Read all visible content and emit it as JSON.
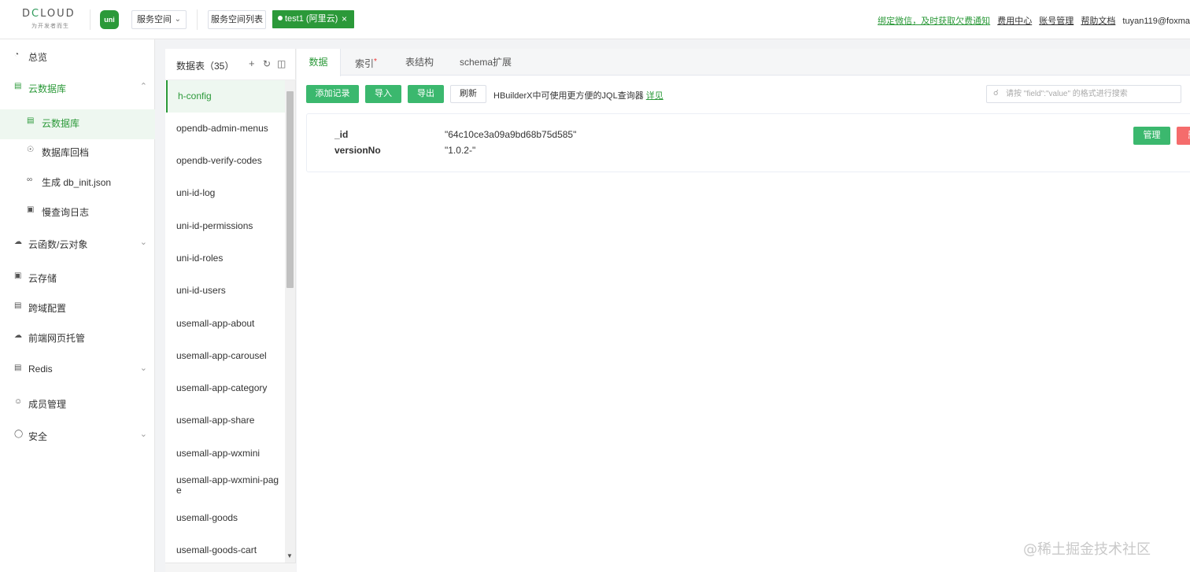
{
  "header": {
    "logo_text": "DCLOUD",
    "logo_sub": "为开发者而生",
    "uni_logo": "uni",
    "space_select": "服务空间",
    "space_list_button": "服务空间列表",
    "env_tag": "test1 (阿里云)",
    "env_close": "×",
    "links": {
      "bind_wechat": "绑定微信，及时获取欠费通知",
      "billing": "费用中心",
      "account": "账号管理",
      "help": "帮助文档"
    },
    "user": "tuyan119@foxma"
  },
  "sidebar": {
    "items": [
      {
        "label": "总览"
      },
      {
        "label": "云数据库"
      },
      {
        "label": "云数据库"
      },
      {
        "label": "数据库回档"
      },
      {
        "label": "生成 db_init.json"
      },
      {
        "label": "慢查询日志"
      },
      {
        "label": "云函数/云对象"
      },
      {
        "label": "云存储"
      },
      {
        "label": "跨域配置"
      },
      {
        "label": "前端网页托管"
      },
      {
        "label": "Redis"
      },
      {
        "label": "成员管理"
      },
      {
        "label": "安全"
      }
    ]
  },
  "tables": {
    "title": "数据表（35）",
    "items": [
      "h-config",
      "opendb-admin-menus",
      "opendb-verify-codes",
      "uni-id-log",
      "uni-id-permissions",
      "uni-id-roles",
      "uni-id-users",
      "usemall-app-about",
      "usemall-app-carousel",
      "usemall-app-category",
      "usemall-app-share",
      "usemall-app-wxmini",
      "usemall-app-wxmini-pag\ne",
      "usemall-goods",
      "usemall-goods-cart"
    ],
    "active_index": 0
  },
  "tabs": [
    {
      "label": "数据"
    },
    {
      "label": "索引",
      "required": "*"
    },
    {
      "label": "表结构"
    },
    {
      "label": "schema扩展"
    }
  ],
  "toolbar": {
    "add": "添加记录",
    "import": "导入",
    "export": "导出",
    "refresh": "刷新",
    "tip": "HBuilderX中可使用更方便的JQL查询器",
    "tip_link": "详见",
    "search_placeholder": "请按 \"field\":\"value\" 的格式进行搜索"
  },
  "record": {
    "fields": [
      {
        "key": "_id",
        "value": "\"64c10ce3a09a9bd68b75d585\""
      },
      {
        "key": "versionNo",
        "value": "\"1.0.2-\""
      }
    ],
    "manage_button": "管理",
    "delete_button": "删"
  },
  "watermark": "@稀土掘金技术社区",
  "colors": {
    "brand_green": "#2b9939",
    "button_green": "#3bb86e",
    "danger_red": "#f56c6c"
  }
}
